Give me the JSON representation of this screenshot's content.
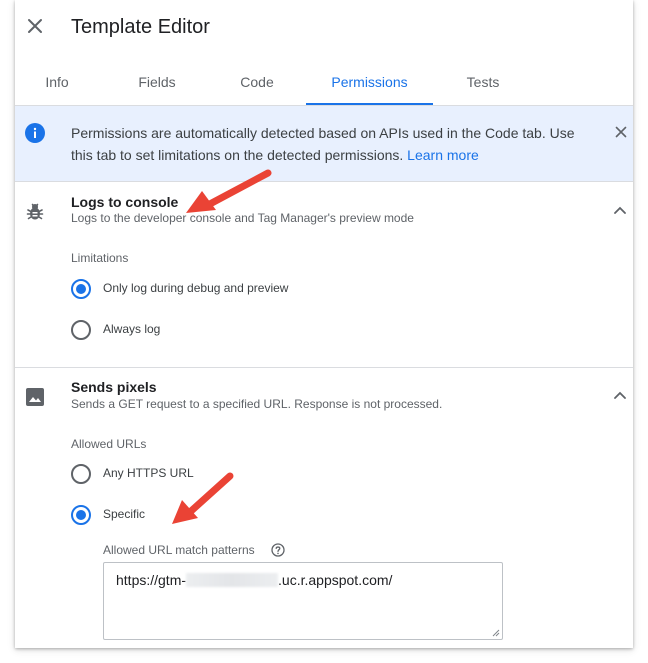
{
  "header": {
    "title": "Template Editor",
    "close_icon": "close-icon"
  },
  "tabs": [
    {
      "label": "Info",
      "active": false
    },
    {
      "label": "Fields",
      "active": false
    },
    {
      "label": "Code",
      "active": false
    },
    {
      "label": "Permissions",
      "active": true
    },
    {
      "label": "Tests",
      "active": false
    }
  ],
  "banner": {
    "icon": "info-icon",
    "text": "Permissions are automatically detected based on APIs used in the Code tab. Use this tab to set limitations on the detected permissions.",
    "link": "Learn more"
  },
  "sections": [
    {
      "icon": "bug-icon",
      "title": "Logs to console",
      "subtitle": "Logs to the developer console and Tag Manager's preview mode",
      "group_label": "Limitations",
      "options": [
        {
          "label": "Only log during debug and preview",
          "checked": true
        },
        {
          "label": "Always log",
          "checked": false
        }
      ]
    },
    {
      "icon": "image-icon",
      "title": "Sends pixels",
      "subtitle": "Sends a GET request to a specified URL. Response is not processed.",
      "group_label": "Allowed URLs",
      "options": [
        {
          "label": "Any HTTPS URL",
          "checked": false
        },
        {
          "label": "Specific",
          "checked": true
        }
      ],
      "field_label": "Allowed URL match patterns",
      "field_value_prefix": "https://gtm-",
      "field_value_suffix": ".uc.r.appspot.com/"
    }
  ],
  "colors": {
    "accent": "#1a73e8",
    "annotation_arrow": "#ea4335",
    "banner_bg": "#e8f0fe"
  }
}
